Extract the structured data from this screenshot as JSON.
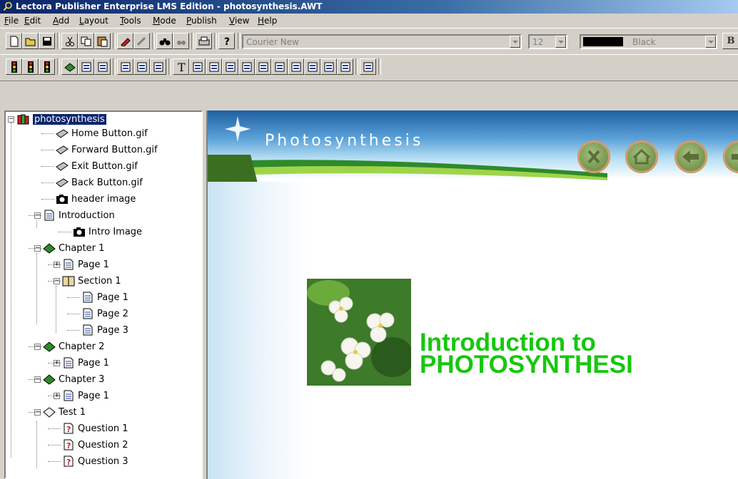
{
  "window": {
    "title": "Lectora Publisher Enterprise LMS Edition - photosynthesis.AWT"
  },
  "menu": [
    "File",
    "Edit",
    "Add",
    "Layout",
    "Tools",
    "Mode",
    "Publish",
    "View",
    "Help"
  ],
  "format_toolbar": {
    "font": "Courier New",
    "size": "12",
    "color_label": "Black",
    "bold_label": "B"
  },
  "tree": {
    "root": "photosynthesis",
    "items": [
      "Home Button.gif",
      "Forward Button.gif",
      "Exit Button.gif",
      "Back Button.gif",
      "header image",
      "Introduction",
      "Intro Image",
      "Chapter 1",
      "Page 1",
      "Section 1",
      "Page 1",
      "Page 2",
      "Page 3",
      "Chapter 2",
      "Page 1",
      "Chapter 3",
      "Page 1",
      "Test 1",
      "Question 1",
      "Question 2",
      "Question 3"
    ]
  },
  "preview": {
    "header_title": "Photosynthesis",
    "intro_line1": "Introduction to",
    "intro_line2": "PHOTOSYNTHESI"
  },
  "colors": {
    "accent_green": "#17c70f",
    "selection": "#0a246a"
  }
}
